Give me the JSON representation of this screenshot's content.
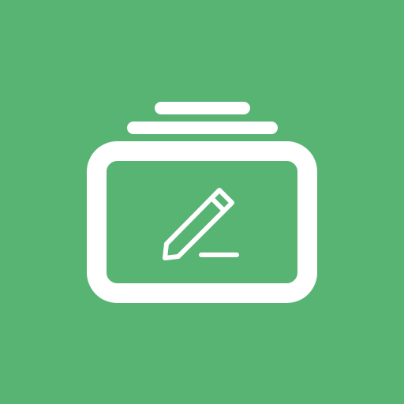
{
  "app_icon": {
    "name": "notes-stack-edit-icon",
    "background_color": "#58B472",
    "foreground_color": "#FFFFFF"
  }
}
